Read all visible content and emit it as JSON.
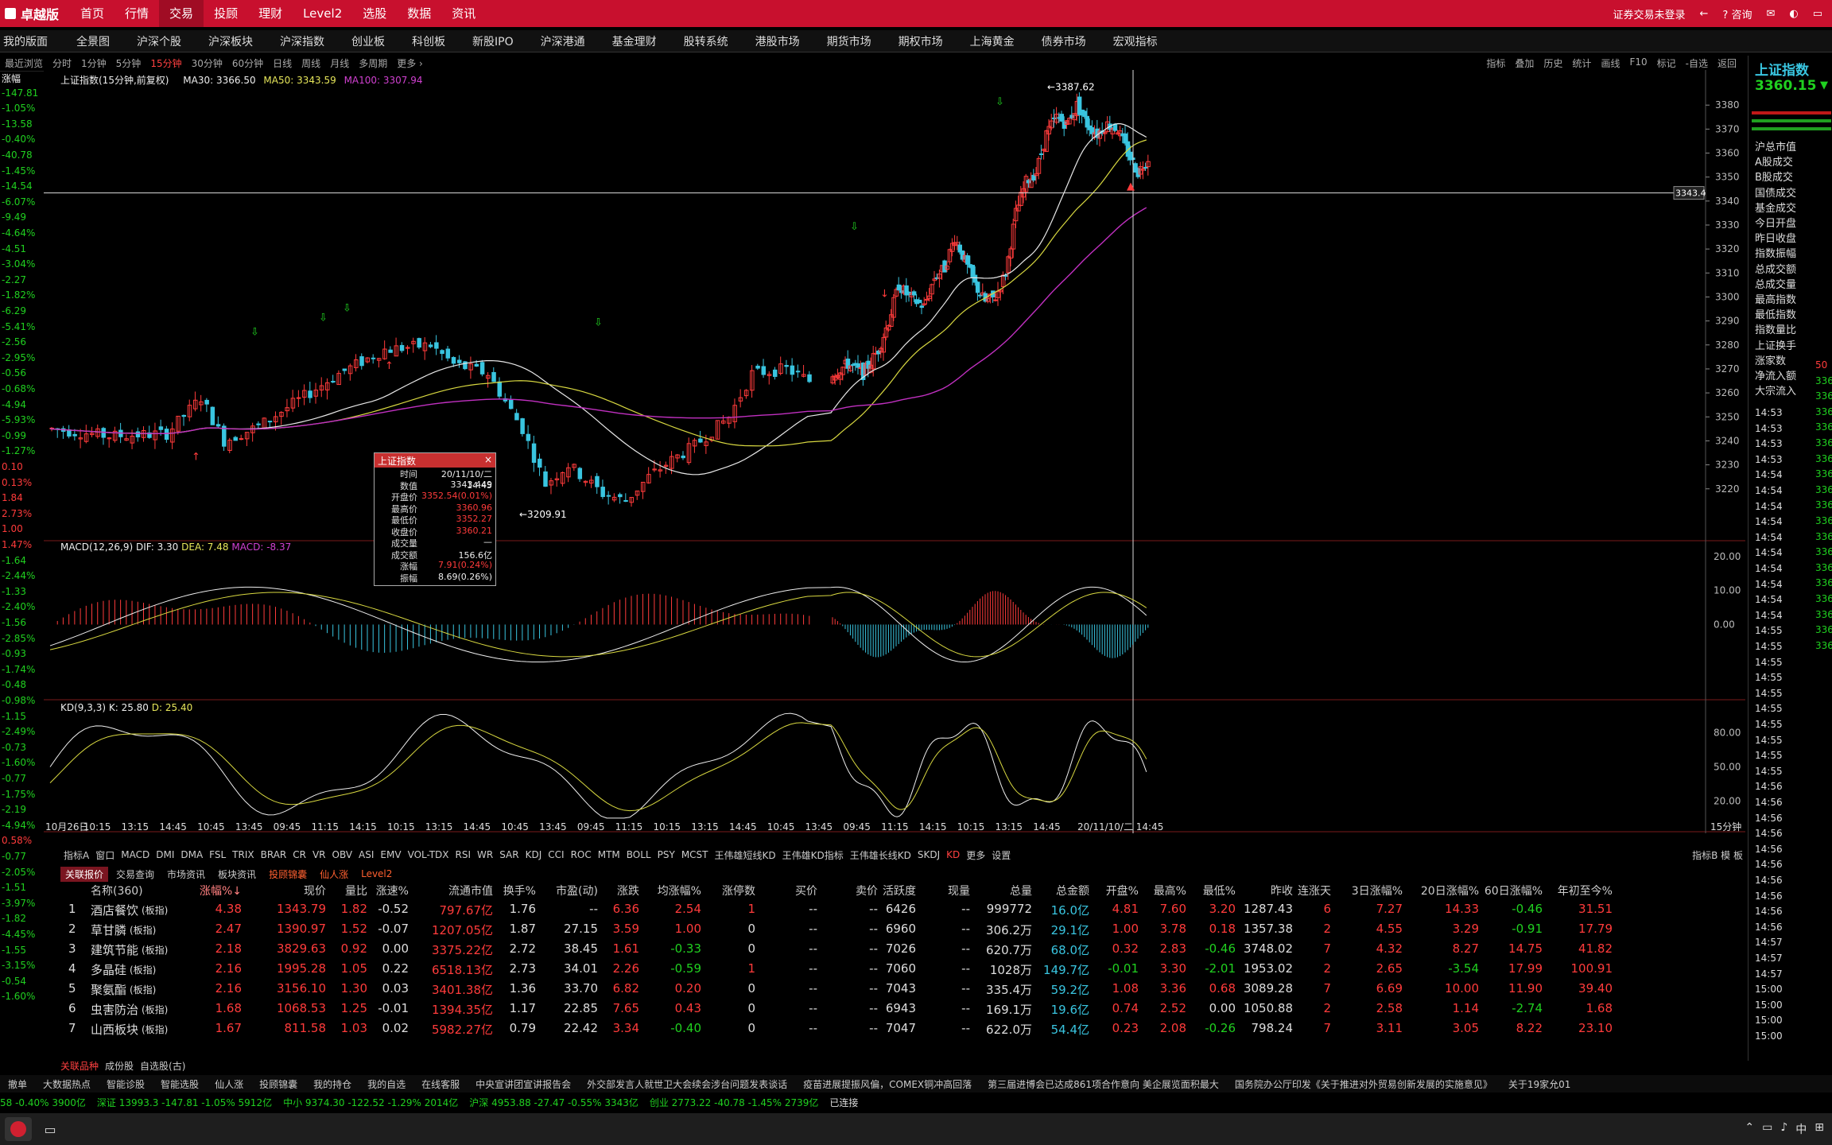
{
  "topbar": {
    "logo": "卓越版",
    "menu": [
      "首页",
      "行情",
      "交易",
      "投顾",
      "理财",
      "Level2",
      "选股",
      "数据",
      "资讯"
    ],
    "active_menu": "交易",
    "login": "证券交易未登录",
    "consult": "咨询"
  },
  "tabbar": [
    "我的版面",
    "全景图",
    "沪深个股",
    "沪深板块",
    "沪深指数",
    "创业板",
    "科创板",
    "新股IPO",
    "沪深港通",
    "基金理财",
    "股转系统",
    "港股市场",
    "期货市场",
    "期权市场",
    "上海黄金",
    "债券市场",
    "宏观指标"
  ],
  "toolbar": {
    "left": [
      "最近浏览",
      "分时",
      "1分钟",
      "5分钟",
      "15分钟",
      "30分钟",
      "60分钟",
      "日线",
      "周线",
      "月线",
      "多周期",
      "更多 ›"
    ],
    "active": "15分钟",
    "right": [
      "指标",
      "叠加",
      "历史",
      "统计",
      "画线",
      "F10",
      "标记",
      "-自选",
      "返回"
    ]
  },
  "chart_title": {
    "name": "上证指数(15分钟,前复权)",
    "ma30": "MA30: 3366.50",
    "ma50": "MA50: 3343.59",
    "ma100": "MA100: 3307.94"
  },
  "left_labels": [
    {
      "t": "涨幅",
      "c": "wht"
    },
    {
      "t": "-147.81",
      "c": "grn"
    },
    {
      "t": "-1.05%",
      "c": "grn"
    },
    {
      "t": "-13.58",
      "c": "grn"
    },
    {
      "t": "-0.40%",
      "c": "grn"
    },
    {
      "t": "-40.78",
      "c": "grn"
    },
    {
      "t": "-1.45%",
      "c": "grn"
    },
    {
      "t": "-14.54",
      "c": "grn"
    },
    {
      "t": "-6.07%",
      "c": "grn"
    },
    {
      "t": "-9.49",
      "c": "grn"
    },
    {
      "t": "-4.64%",
      "c": "grn"
    },
    {
      "t": "-4.51",
      "c": "grn"
    },
    {
      "t": "-3.04%",
      "c": "grn"
    },
    {
      "t": "-2.27",
      "c": "grn"
    },
    {
      "t": "-1.82%",
      "c": "grn"
    },
    {
      "t": "-6.29",
      "c": "grn"
    },
    {
      "t": "-5.41%",
      "c": "grn"
    },
    {
      "t": "-2.56",
      "c": "grn"
    },
    {
      "t": "-2.95%",
      "c": "grn"
    },
    {
      "t": "-0.56",
      "c": "grn"
    },
    {
      "t": "-0.68%",
      "c": "grn"
    },
    {
      "t": "-4.94",
      "c": "grn"
    },
    {
      "t": "-5.93%",
      "c": "grn"
    },
    {
      "t": "-0.99",
      "c": "grn"
    },
    {
      "t": "-1.27%",
      "c": "grn"
    },
    {
      "t": "0.10",
      "c": "red"
    },
    {
      "t": "0.13%",
      "c": "red"
    },
    {
      "t": "1.84",
      "c": "red"
    },
    {
      "t": "2.73%",
      "c": "red"
    },
    {
      "t": "1.00",
      "c": "red"
    },
    {
      "t": "1.47%",
      "c": "red"
    },
    {
      "t": "-1.64",
      "c": "grn"
    },
    {
      "t": "-2.44%",
      "c": "grn"
    },
    {
      "t": "-1.33",
      "c": "grn"
    },
    {
      "t": "-2.40%",
      "c": "grn"
    },
    {
      "t": "-1.56",
      "c": "grn"
    },
    {
      "t": "-2.85%",
      "c": "grn"
    },
    {
      "t": "-0.93",
      "c": "grn"
    },
    {
      "t": "-1.74%",
      "c": "grn"
    },
    {
      "t": "-0.48",
      "c": "grn"
    },
    {
      "t": "-0.98%",
      "c": "grn"
    },
    {
      "t": "-1.15",
      "c": "grn"
    },
    {
      "t": "-2.49%",
      "c": "grn"
    },
    {
      "t": "-0.73",
      "c": "grn"
    },
    {
      "t": "-1.60%",
      "c": "grn"
    },
    {
      "t": "-0.77",
      "c": "grn"
    },
    {
      "t": "-1.75%",
      "c": "grn"
    },
    {
      "t": "-2.19",
      "c": "grn"
    },
    {
      "t": "-4.94%",
      "c": "grn"
    },
    {
      "t": "0.58%",
      "c": "red"
    },
    {
      "t": "-0.77",
      "c": "grn"
    },
    {
      "t": "-2.05%",
      "c": "grn"
    },
    {
      "t": "-1.51",
      "c": "grn"
    },
    {
      "t": "-3.97%",
      "c": "grn"
    },
    {
      "t": "-1.82",
      "c": "grn"
    },
    {
      "t": "-4.45%",
      "c": "grn"
    },
    {
      "t": "-1.55",
      "c": "grn"
    },
    {
      "t": "-3.15%",
      "c": "grn"
    },
    {
      "t": "-0.54",
      "c": "grn"
    },
    {
      "t": "-1.60%",
      "c": "grn"
    }
  ],
  "price_axis": [
    "3380",
    "3370",
    "3360",
    "3350",
    "3340",
    "3330",
    "3320",
    "3310",
    "3300",
    "3290",
    "3280",
    "3270",
    "3260",
    "3250",
    "3240",
    "3230",
    "3220"
  ],
  "cross_value": "3343.4",
  "annotations": {
    "high": "3387.62",
    "low": "3209.91"
  },
  "tooltip": {
    "title": "上证指数",
    "rows": [
      {
        "k": "时间",
        "v": "20/11/10/二 14:45",
        "c": "wht"
      },
      {
        "k": "数值",
        "v": "3343.449",
        "c": "wht"
      },
      {
        "k": "开盘价",
        "v": "3352.54(0.01%)",
        "c": "red"
      },
      {
        "k": "最高价",
        "v": "3360.96",
        "c": "red"
      },
      {
        "k": "最低价",
        "v": "3352.27",
        "c": "red"
      },
      {
        "k": "收盘价",
        "v": "3360.21",
        "c": "red"
      },
      {
        "k": "成交量",
        "v": "—",
        "c": "wht"
      },
      {
        "k": "成交额",
        "v": "156.6亿",
        "c": "wht"
      },
      {
        "k": "涨幅",
        "v": "7.91(0.24%)",
        "c": "red"
      },
      {
        "k": "振幅",
        "v": "8.69(0.26%)",
        "c": "wht"
      }
    ]
  },
  "macd": {
    "title": "MACD(12,26,9)",
    "dif": "DIF: 3.30",
    "dea": "DEA: 7.48",
    "macd": "MACD: -8.37",
    "axis": [
      "20.00",
      "10.00",
      "0.00"
    ]
  },
  "kd": {
    "title": "KD(9,3,3)",
    "k": "K: 25.80",
    "d": "D: 25.40",
    "axis": [
      "80.00",
      "50.00",
      "20.00"
    ]
  },
  "time_axis": [
    "10月26日",
    "10:15",
    "13:15",
    "14:45",
    "10:45",
    "13:45",
    "09:45",
    "11:15",
    "14:15",
    "10:15",
    "13:15",
    "14:45",
    "10:45",
    "13:45",
    "09:45",
    "11:15",
    "10:15",
    "13:15",
    "14:45",
    "10:45",
    "13:45",
    "09:45",
    "11:15",
    "14:15",
    "10:15",
    "13:15",
    "14:45",
    "20/11/10/二 14:45",
    "15分钟"
  ],
  "indicators": [
    "指标A",
    "窗口",
    "MACD",
    "DMI",
    "DMA",
    "FSL",
    "TRIX",
    "BRAR",
    "CR",
    "VR",
    "OBV",
    "ASI",
    "EMV",
    "VOL-TDX",
    "RSI",
    "WR",
    "SAR",
    "KDJ",
    "CCI",
    "ROC",
    "MTM",
    "BOLL",
    "PSY",
    "MCST",
    "王伟雄短线KD",
    "王伟雄KD指标",
    "王伟雄长线KD",
    "SKDJ",
    "KD",
    "更多",
    "设置"
  ],
  "indicators_right": "指标B 模 板",
  "subtabs": [
    "关联报价",
    "交易查询",
    "市场资讯",
    "板块资讯",
    "投顾锦囊",
    "仙人涨",
    "Level2"
  ],
  "table_headers": [
    "名称(360)",
    "涨幅%↓",
    "现价",
    "量比",
    "涨速%",
    "流通市值",
    "换手%",
    "市盈(动)",
    "涨跌",
    "均涨幅%",
    "涨停数",
    "买价",
    "卖价",
    "活跃度",
    "现量",
    "总量",
    "总金额",
    "开盘%",
    "最高%",
    "最低%",
    "昨收",
    "连涨天",
    "3日涨幅%",
    "20日涨幅%",
    "60日涨幅%",
    "年初至今%"
  ],
  "rows": [
    [
      "1",
      "酒店餐饮",
      "4.38",
      "1343.79",
      "1.82",
      "-0.52",
      "797.67亿",
      "1.76",
      "--",
      "6.36",
      "2.54",
      "1",
      "--",
      "--",
      "6426",
      "--",
      "999772",
      "16.0亿",
      "4.81",
      "7.60",
      "3.20",
      "1287.43",
      "6",
      "7.27",
      "14.33",
      "-0.46",
      "31.51"
    ],
    [
      "2",
      "草甘膦",
      "2.47",
      "1390.97",
      "1.52",
      "-0.07",
      "1207.05亿",
      "1.87",
      "27.15",
      "3.59",
      "1.00",
      "0",
      "--",
      "--",
      "6960",
      "--",
      "306.2万",
      "29.1亿",
      "1.00",
      "3.78",
      "0.18",
      "1357.38",
      "2",
      "4.55",
      "3.29",
      "-0.91",
      "17.79"
    ],
    [
      "3",
      "建筑节能",
      "2.18",
      "3829.63",
      "0.92",
      "0.00",
      "3375.22亿",
      "2.72",
      "38.45",
      "1.61",
      "-0.33",
      "0",
      "--",
      "--",
      "7026",
      "--",
      "620.7万",
      "68.0亿",
      "0.32",
      "2.83",
      "-0.46",
      "3748.02",
      "7",
      "4.32",
      "8.27",
      "14.75",
      "41.82"
    ],
    [
      "4",
      "多晶硅",
      "2.16",
      "1995.28",
      "1.05",
      "0.22",
      "6518.13亿",
      "2.73",
      "34.01",
      "2.26",
      "-0.59",
      "1",
      "--",
      "--",
      "7060",
      "--",
      "1028万",
      "149.7亿",
      "-0.01",
      "3.30",
      "-2.01",
      "1953.02",
      "2",
      "2.65",
      "-3.54",
      "17.99",
      "100.91"
    ],
    [
      "5",
      "聚氨酯",
      "2.16",
      "3156.10",
      "1.30",
      "0.03",
      "3401.38亿",
      "1.36",
      "33.70",
      "6.82",
      "0.20",
      "0",
      "--",
      "--",
      "7043",
      "--",
      "335.4万",
      "59.2亿",
      "1.08",
      "3.36",
      "0.68",
      "3089.28",
      "7",
      "6.69",
      "10.00",
      "11.90",
      "39.40"
    ],
    [
      "6",
      "虫害防治",
      "1.68",
      "1068.53",
      "1.25",
      "-0.01",
      "1394.35亿",
      "1.17",
      "22.85",
      "7.65",
      "0.43",
      "0",
      "--",
      "--",
      "6943",
      "--",
      "169.1万",
      "19.6亿",
      "0.74",
      "2.52",
      "0.00",
      "1050.88",
      "2",
      "2.58",
      "1.14",
      "-2.74",
      "1.68"
    ],
    [
      "7",
      "山西板块",
      "1.67",
      "811.58",
      "1.03",
      "0.02",
      "5982.27亿",
      "0.79",
      "22.42",
      "3.34",
      "-0.40",
      "0",
      "--",
      "--",
      "7047",
      "--",
      "622.0万",
      "54.4亿",
      "0.23",
      "2.08",
      "-0.26",
      "798.24",
      "7",
      "3.11",
      "3.05",
      "8.22",
      "23.10"
    ]
  ],
  "row_tag": "(板指)",
  "bottom_tabs": [
    "关联品种",
    "成份股",
    "自选股(古)"
  ],
  "news": [
    "撤单",
    "大数据热点",
    "智能诊股",
    "智能选股",
    "仙人涨",
    "投顾锦囊",
    "我的持仓",
    "我的自选",
    "在线客服",
    "中央宣讲团宣讲报告会",
    "外交部发言人就世卫大会续会涉台问题发表谈话",
    "疫苗进展提振风偏，COMEX铜冲高回落",
    "第三届进博会已达成861项合作意向 美企展览面积最大",
    "国务院办公厅印发《关于推进对外贸易创新发展的实施意见》",
    "关于19家允01"
  ],
  "status": [
    "58 -0.40% 3900亿",
    "深证 13993.3 -147.81 -1.05% 5912亿",
    "中小 9374.30 -122.52 -1.29% 2014亿",
    "沪深 4953.88 -27.47 -0.55% 3343亿",
    "创业 2773.22 -40.78 -1.45% 2739亿",
    "已连接"
  ],
  "right_panel": {
    "header": "上证指数",
    "price": "3360.15",
    "arrow": "▼",
    "labels": [
      "沪总市值",
      "A股成交",
      "B股成交",
      "国债成交",
      "基金成交",
      "今日开盘",
      "昨日收盘",
      "指数振幅",
      "总成交额",
      "总成交量",
      "最高指数",
      "最低指数",
      "指数量比",
      "上证换手",
      "涨家数",
      "净流入额",
      "大宗流入"
    ],
    "times": [
      "14:53",
      "14:53",
      "14:53",
      "14:53",
      "14:54",
      "14:54",
      "14:54",
      "14:54",
      "14:54",
      "14:54",
      "14:54",
      "14:54",
      "14:54",
      "14:54",
      "14:55",
      "14:55",
      "14:55",
      "14:55",
      "14:55",
      "14:55",
      "14:55",
      "14:55",
      "14:55",
      "14:55",
      "14:56",
      "14:56",
      "14:56",
      "14:56",
      "14:56",
      "14:56",
      "14:56",
      "14:56",
      "14:56",
      "14:56",
      "14:57",
      "14:57",
      "14:57",
      "15:00",
      "15:00",
      "15:00",
      "15:00"
    ],
    "side_vals": [
      "50",
      "336",
      "336",
      "336",
      "336",
      "336",
      "336",
      "336",
      "336",
      "336",
      "336",
      "336",
      "336",
      "336",
      "336",
      "336",
      "336",
      "336",
      "336"
    ]
  },
  "taskbar": {
    "tray": [
      "⌃",
      "▭",
      "♪",
      "中",
      "⊞"
    ]
  }
}
